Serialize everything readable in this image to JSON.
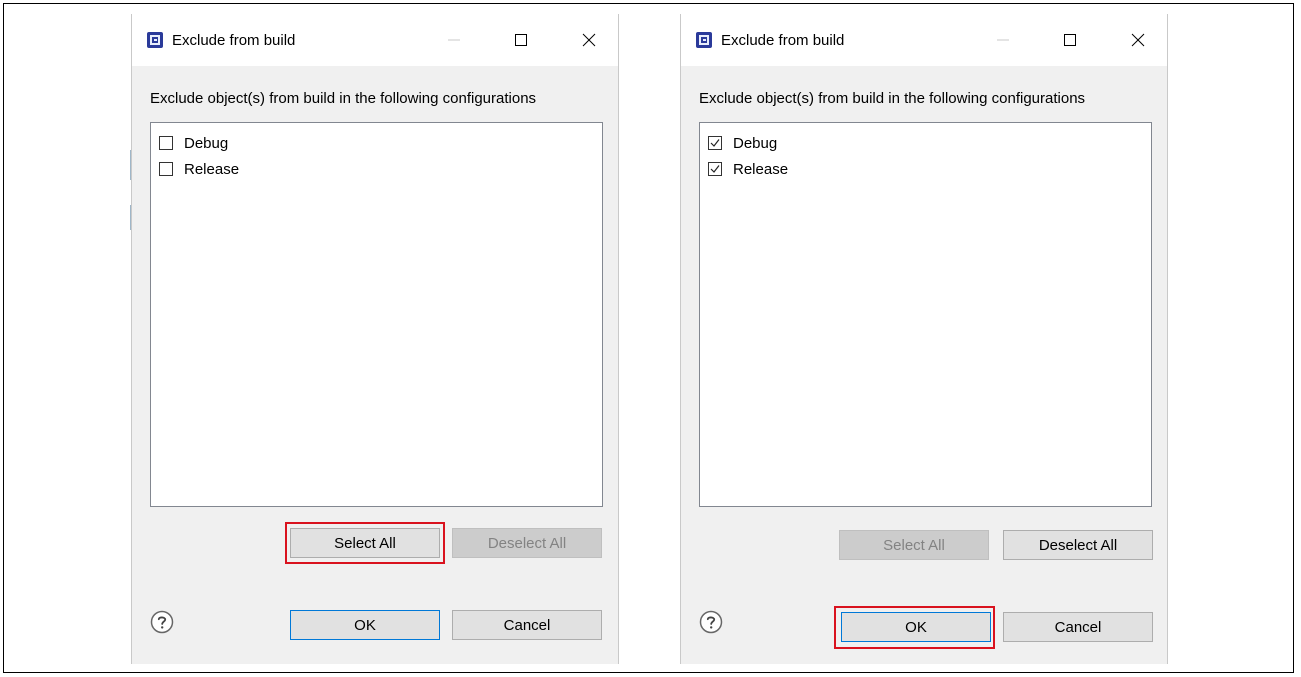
{
  "dialogs": [
    {
      "title": "Exclude from build",
      "prompt": "Exclude object(s) from build in the following configurations",
      "items": [
        {
          "label": "Debug",
          "checked": false
        },
        {
          "label": "Release",
          "checked": false
        }
      ],
      "select_all_label": "Select All",
      "deselect_all_label": "Deselect All",
      "ok_label": "OK",
      "cancel_label": "Cancel",
      "select_all_enabled": true,
      "deselect_all_enabled": false,
      "highlighted": "select-all"
    },
    {
      "title": "Exclude from build",
      "prompt": "Exclude object(s) from build in the following configurations",
      "items": [
        {
          "label": "Debug",
          "checked": true
        },
        {
          "label": "Release",
          "checked": true
        }
      ],
      "select_all_label": "Select All",
      "deselect_all_label": "Deselect All",
      "ok_label": "OK",
      "cancel_label": "Cancel",
      "select_all_enabled": false,
      "deselect_all_enabled": true,
      "highlighted": "ok"
    }
  ],
  "colors": {
    "highlight": "#d9121e",
    "default_button_border": "#0078d7",
    "dialog_background": "#f0f0f0"
  },
  "icons": [
    "app-chip-icon",
    "minimize-icon",
    "maximize-icon",
    "close-icon",
    "help-icon",
    "checkmark-icon"
  ]
}
